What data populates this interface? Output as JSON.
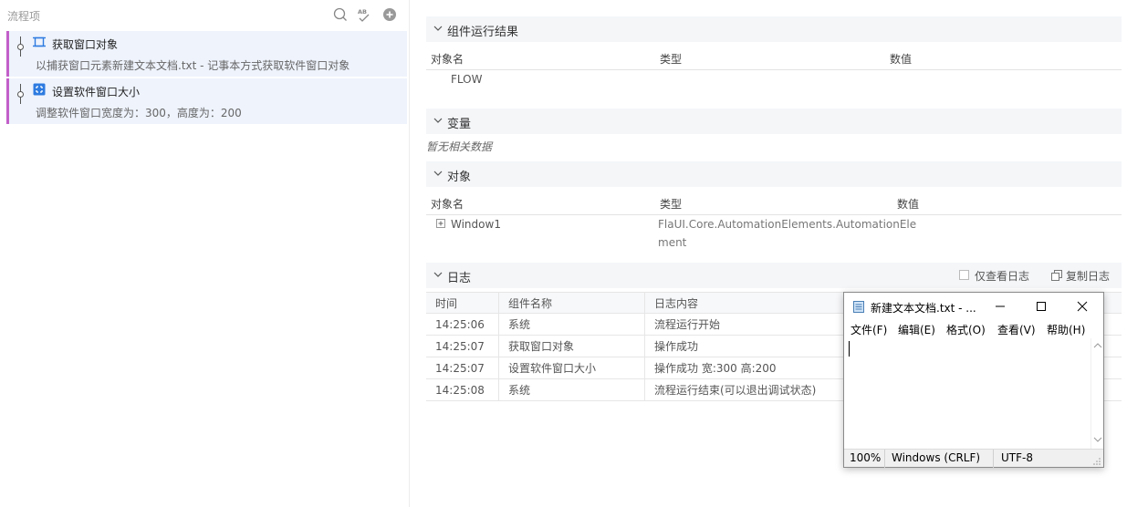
{
  "left_panel": {
    "title": "流程项",
    "header_icons": [
      "search-icon",
      "spellcheck-icon",
      "add-circle-icon"
    ],
    "items": [
      {
        "title": "获取窗口对象",
        "desc": "以捕获窗口元素新建文本文档.txt - 记事本方式获取软件窗口对象",
        "icon": "window-capture-icon"
      },
      {
        "title": "设置软件窗口大小",
        "desc": "调整软件窗口宽度为：300，高度为：200",
        "icon": "resize-window-icon"
      }
    ]
  },
  "sections": {
    "results": {
      "label": "组件运行结果",
      "columns": [
        "对象名",
        "类型",
        "数值"
      ],
      "rows": [
        {
          "name": "FLOW",
          "type": "",
          "value": ""
        }
      ]
    },
    "variables": {
      "label": "变量",
      "empty": "暂无相关数据"
    },
    "objects": {
      "label": "对象",
      "columns": [
        "对象名",
        "类型",
        "数值"
      ],
      "rows": [
        {
          "name": "Window1",
          "type_line1": "FlaUI.Core.AutomationElements.AutomationEle",
          "type_line2": "ment",
          "value": ""
        }
      ]
    },
    "log": {
      "label": "日志",
      "only_log_label": "仅查看日志",
      "copy_label": "复制日志",
      "columns": [
        "时间",
        "组件名称",
        "日志内容"
      ],
      "rows": [
        {
          "time": "14:25:06",
          "component": "系统",
          "content": "流程运行开始"
        },
        {
          "time": "14:25:07",
          "component": "获取窗口对象",
          "content": "操作成功"
        },
        {
          "time": "14:25:07",
          "component": "设置软件窗口大小",
          "content": "操作成功 宽:300 高:200"
        },
        {
          "time": "14:25:08",
          "component": "系统",
          "content": "流程运行结束(可以退出调试状态)"
        }
      ]
    }
  },
  "notepad": {
    "title": "新建文本文档.txt - ...",
    "menu": [
      "文件(F)",
      "编辑(E)",
      "格式(O)",
      "查看(V)",
      "帮助(H)"
    ],
    "status": {
      "zoom": "100%",
      "line_ending": "Windows (CRLF)",
      "encoding": "UTF-8"
    }
  },
  "colors": {
    "accent_bar": "#c35fc9",
    "item_bg": "#eef3fc",
    "icon_blue": "#2e7be0",
    "section_bg": "#f4f6f8"
  }
}
